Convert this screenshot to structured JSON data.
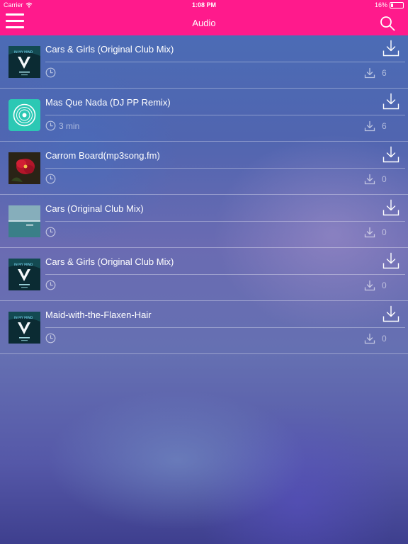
{
  "status_bar": {
    "carrier": "Carrier",
    "time": "1:08 PM",
    "battery": "16%",
    "battery_level": 0.16
  },
  "nav": {
    "title": "Audio",
    "menu_icon": "hamburger-menu-icon",
    "search_icon": "search-icon"
  },
  "colors": {
    "nav_bg": "#ff1a8c",
    "text": "#ffffff",
    "muted": "rgba(255,255,255,0.55)"
  },
  "tracks": [
    {
      "title": "Cars & Girls (Original Club Mix)",
      "duration": "",
      "downloads": "6",
      "art": "in-my-mind"
    },
    {
      "title": "Mas Que Nada (DJ PP Remix)",
      "duration": "3 min",
      "downloads": "6",
      "art": "vinyl"
    },
    {
      "title": "Carrom Board(mp3song.fm)",
      "duration": "",
      "downloads": "0",
      "art": "flower"
    },
    {
      "title": "Cars (Original Club Mix)",
      "duration": "",
      "downloads": "0",
      "art": "sea"
    },
    {
      "title": "Cars & Girls (Original Club Mix)",
      "duration": "",
      "downloads": "0",
      "art": "in-my-mind"
    },
    {
      "title": "Maid-with-the-Flaxen-Hair",
      "duration": "",
      "downloads": "0",
      "art": "in-my-mind"
    }
  ]
}
